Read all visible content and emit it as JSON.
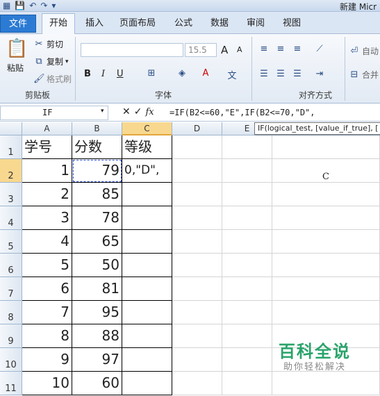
{
  "window": {
    "title": "新建 Micr"
  },
  "tabs": {
    "file": "文件",
    "home": "开始",
    "insert": "插入",
    "layout": "页面布局",
    "formulas": "公式",
    "data": "数据",
    "review": "审阅",
    "view": "视图"
  },
  "ribbon": {
    "clipboard": {
      "paste": "粘贴",
      "cut": "剪切",
      "copy": "复制",
      "format_painter": "格式刷",
      "label": "剪贴板"
    },
    "font": {
      "size": "15.5",
      "label": "字体",
      "bold": "B",
      "italic": "I",
      "underline": "U",
      "grow": "A",
      "shrink": "A"
    },
    "alignment": {
      "label": "对齐方式",
      "wrap": "自动",
      "merge": "合并"
    }
  },
  "formula_bar": {
    "name_box": "IF",
    "formula": "=IF(B2<=60,\"E\",IF(B2<=70,\"D\",",
    "fx": "fx",
    "cancel": "✕",
    "enter": "✓"
  },
  "tooltip": "IF(logical_test, [value_if_true], [",
  "columns": [
    "A",
    "B",
    "C",
    "D",
    "E"
  ],
  "rows": [
    "1",
    "2",
    "3",
    "4",
    "5",
    "6",
    "7",
    "8",
    "9",
    "10",
    "11"
  ],
  "header": {
    "a": "学号",
    "b": "分数",
    "c": "等级"
  },
  "data_rows": [
    {
      "id": "1",
      "score": "79",
      "grade": "0,\"D\","
    },
    {
      "id": "2",
      "score": "85",
      "grade": ""
    },
    {
      "id": "3",
      "score": "78",
      "grade": ""
    },
    {
      "id": "4",
      "score": "65",
      "grade": ""
    },
    {
      "id": "5",
      "score": "50",
      "grade": ""
    },
    {
      "id": "6",
      "score": "81",
      "grade": ""
    },
    {
      "id": "7",
      "score": "95",
      "grade": ""
    },
    {
      "id": "8",
      "score": "88",
      "grade": ""
    },
    {
      "id": "9",
      "score": "97",
      "grade": ""
    },
    {
      "id": "10",
      "score": "60",
      "grade": ""
    }
  ],
  "stray_text": "C",
  "watermark": {
    "title": "百科全说",
    "subtitle": "助你轻松解决"
  },
  "colors": {
    "accent": "#2b7bd4",
    "selected_header": "#f8d88f",
    "watermark": "#2aa36b"
  }
}
